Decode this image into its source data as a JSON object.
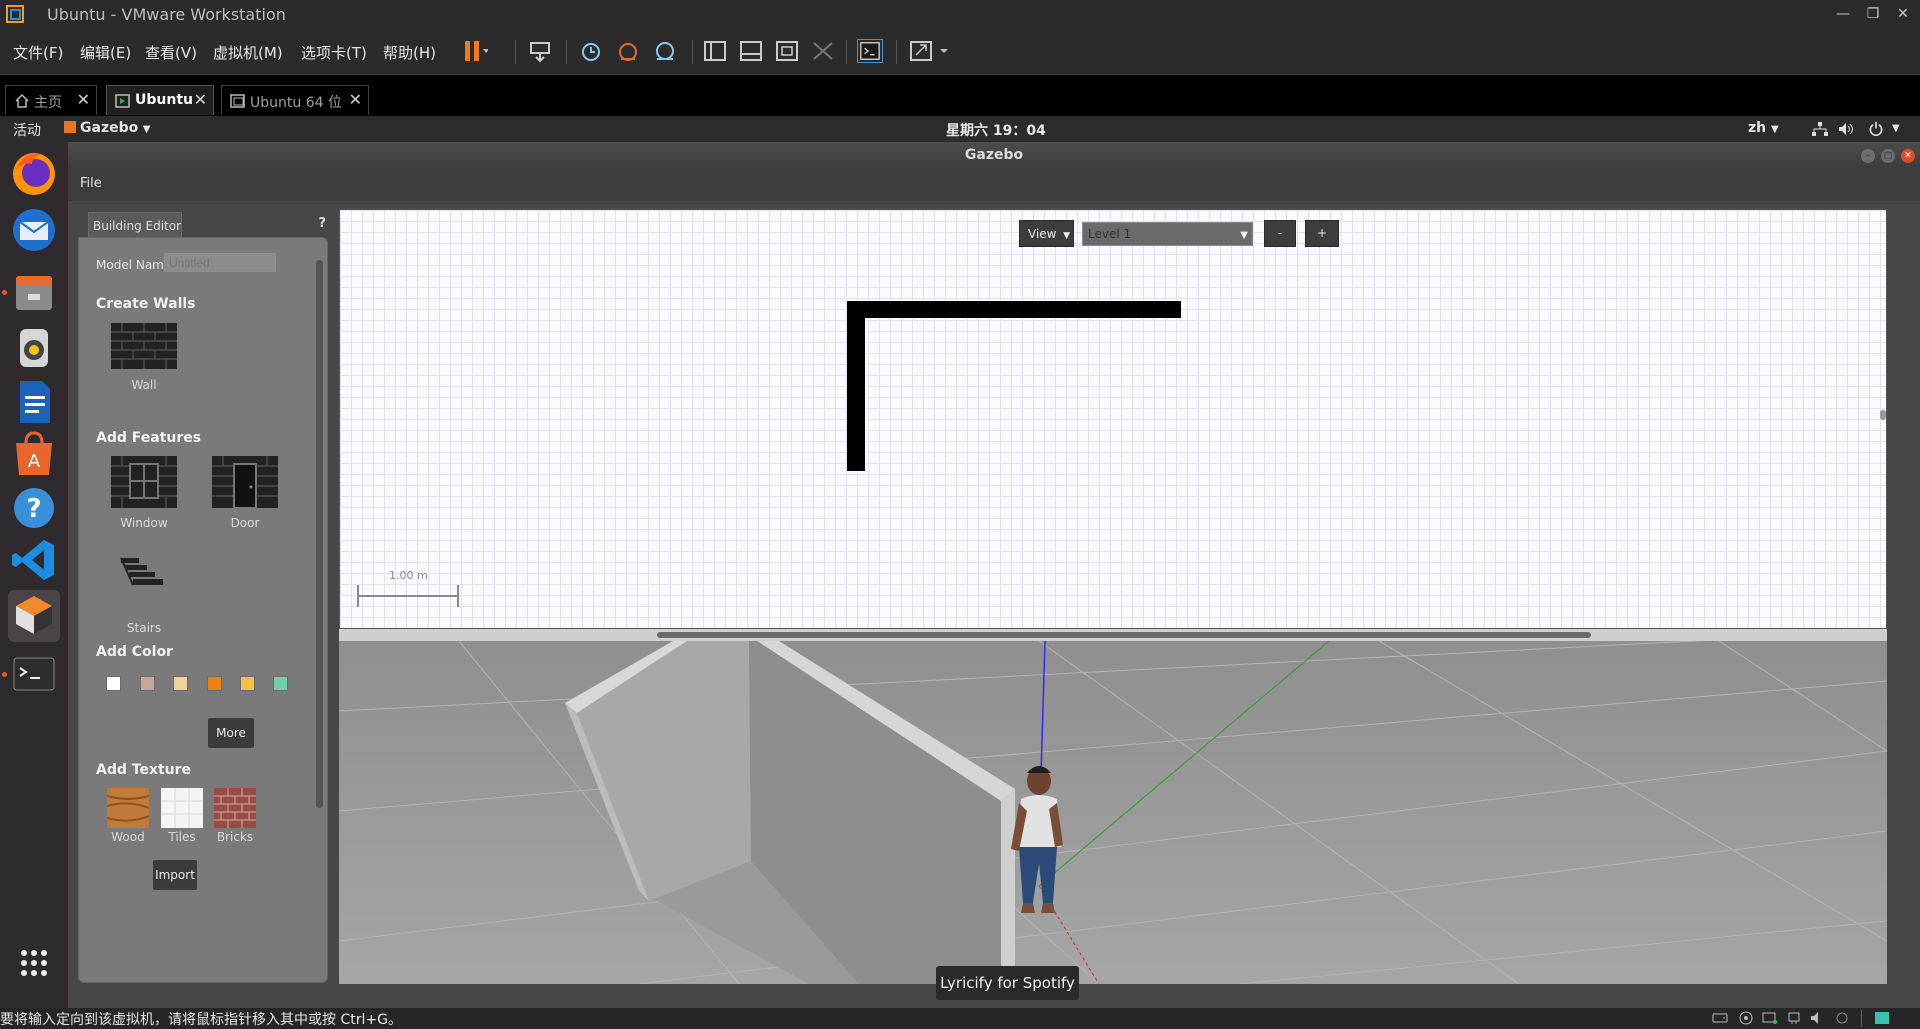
{
  "vmware": {
    "title": "Ubuntu - VMware Workstation",
    "menus": [
      "文件(F)",
      "编辑(E)",
      "查看(V)",
      "虚拟机(M)",
      "选项卡(T)",
      "帮助(H)"
    ],
    "tabs": [
      {
        "label": "主页",
        "active": false
      },
      {
        "label": "Ubuntu",
        "active": true
      },
      {
        "label": "Ubuntu 64 位",
        "active": false
      }
    ],
    "status_message": "要将输入定向到该虚拟机，请将鼠标指针移入其中或按 Ctrl+G。"
  },
  "ubuntu": {
    "activities": "活动",
    "app_menu": "Gazebo",
    "clock": "星期六 19：04",
    "lang": "zh",
    "dock": [
      "firefox-icon",
      "thunderbird-icon",
      "files-icon",
      "rhythmbox-icon",
      "writer-icon",
      "software-icon",
      "help-icon",
      "vscode-icon",
      "gazebo-icon",
      "terminal-icon",
      "app-grid-icon"
    ]
  },
  "gazebo": {
    "window_title": "Gazebo",
    "menu_file": "File",
    "palette": {
      "tab": "Building Editor",
      "help": "?",
      "model_name_label": "Model Name:",
      "model_name_placeholder": "Untitled",
      "create_walls": "Create Walls",
      "wall": "Wall",
      "add_features": "Add Features",
      "window": "Window",
      "door": "Door",
      "stairs": "Stairs",
      "add_color": "Add Color",
      "colors": [
        "#ffffff",
        "#c8a89a",
        "#f0d2a0",
        "#f08010",
        "#f8c040",
        "#70d0a8"
      ],
      "more": "More",
      "add_texture": "Add Texture",
      "textures": [
        "Wood",
        "Tiles",
        "Bricks"
      ],
      "import": "Import"
    },
    "editor": {
      "view": "View",
      "level": "Level 1",
      "minus": "-",
      "plus": "+",
      "scale": "1.00 m"
    }
  },
  "tooltip": "Lyricify for Spotify"
}
